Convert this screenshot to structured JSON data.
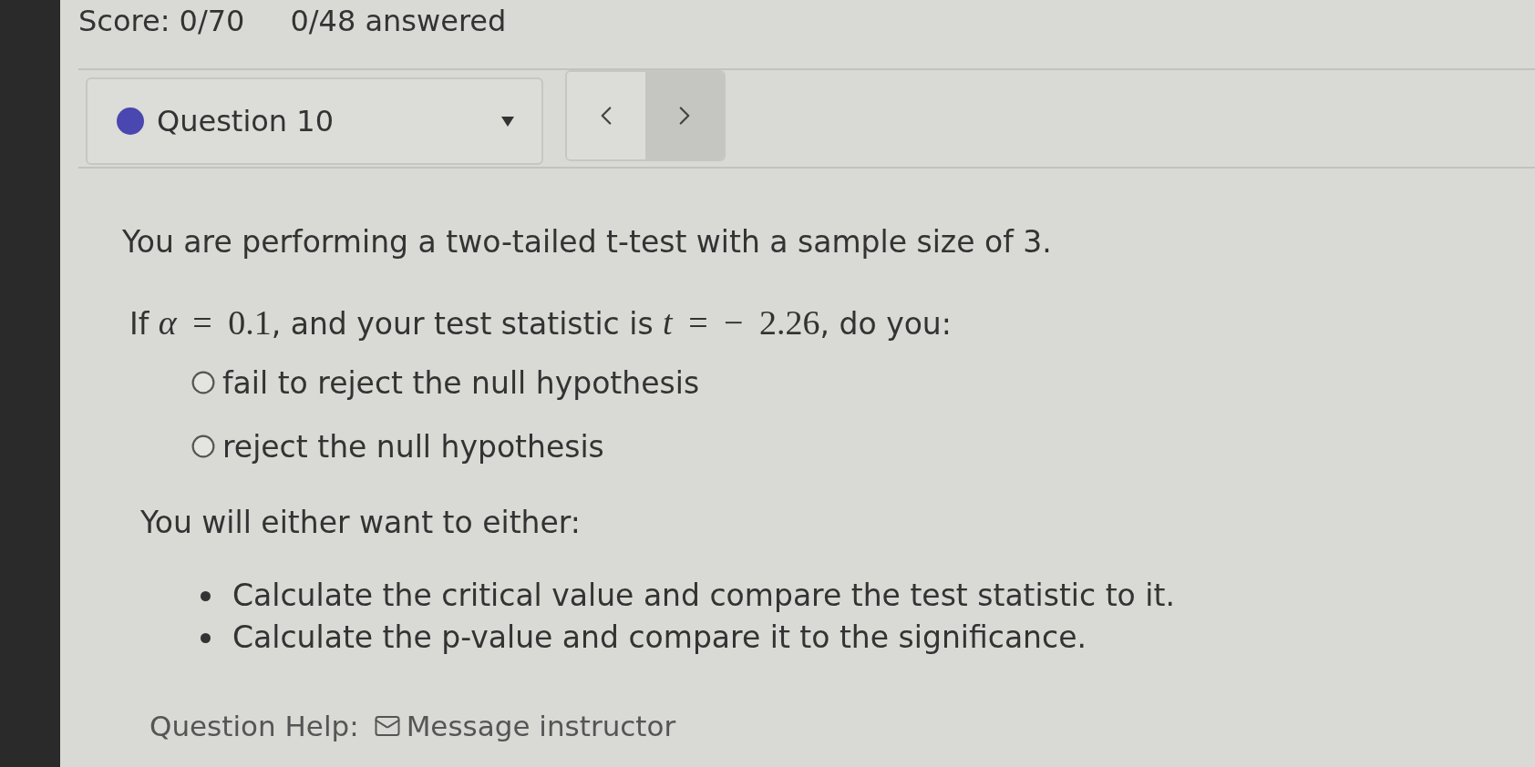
{
  "header": {
    "score": "Score: 0/70",
    "answered": "0/48 answered"
  },
  "question_select": {
    "label": "Question 10",
    "color": "#4a47b0"
  },
  "nav": [
    {
      "kind": "prev",
      "highlighted": false
    },
    {
      "kind": "next",
      "highlighted": true
    }
  ],
  "question": {
    "intro": "You are performing a two-tailed t-test with a sample size of 3.",
    "prompt": [
      {
        "kind": "text",
        "text": "If "
      },
      {
        "kind": "math",
        "text": "*α* = 0.1"
      },
      {
        "kind": "text",
        "text": ", and your test statistic is "
      },
      {
        "kind": "math",
        "text": "*t* =  − 2.26"
      },
      {
        "kind": "text",
        "text": ", do you:"
      }
    ],
    "options": [
      {
        "label": "fail to reject the null hypothesis",
        "selected": false
      },
      {
        "label": "reject the null hypothesis",
        "selected": false
      }
    ],
    "hint": "You will either want to either:",
    "steps": [
      "Calculate the critical value and compare the test statistic to it.",
      "Calculate the p-value and compare it to the significance."
    ]
  },
  "help": {
    "label": "Question Help:",
    "link": "Message instructor"
  }
}
